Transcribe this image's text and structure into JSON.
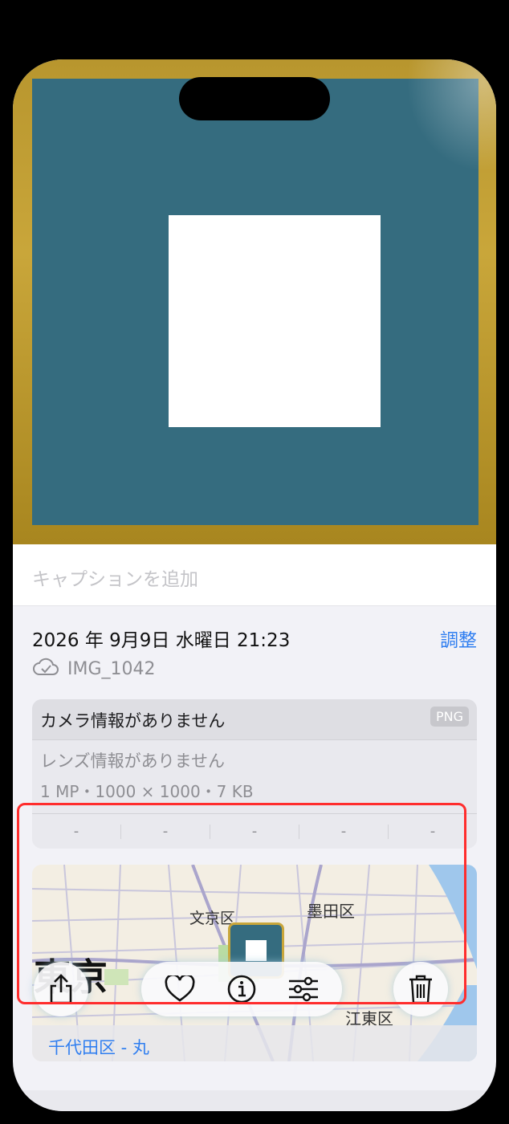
{
  "caption": {
    "placeholder": "キャプションを追加"
  },
  "info": {
    "datetime": "2026 年 9月9日 水曜日 21:23",
    "adjust_label": "調整",
    "filename": "IMG_1042",
    "camera": "カメラ情報がありません",
    "format_badge": "PNG",
    "lens": "レンズ情報がありません",
    "specs": "1 MP・1000 × 1000・7 KB",
    "exif_cells": [
      "-",
      "-",
      "-",
      "-",
      "-"
    ]
  },
  "map": {
    "city_label": "東京",
    "district_labels": [
      "文京区",
      "墨田区",
      "江東区"
    ],
    "address_partial": "千代田区 - 丸"
  },
  "toolbar": {
    "icons": [
      "share-icon",
      "heart-icon",
      "info-icon",
      "sliders-icon",
      "trash-icon"
    ]
  },
  "colors": {
    "accent": "#2f7ef0",
    "photo_teal": "#356c7f",
    "photo_gold": "#c9a63a",
    "highlight_frame": "#ff2d2d"
  }
}
